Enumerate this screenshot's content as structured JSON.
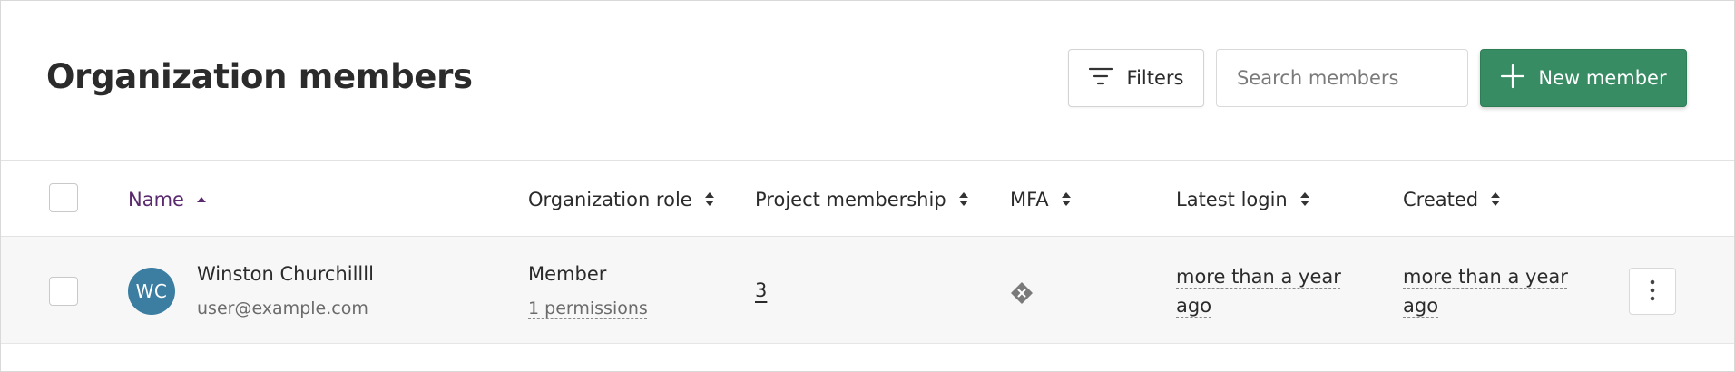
{
  "header": {
    "title": "Organization members",
    "filters_label": "Filters",
    "search_placeholder": "Search members",
    "new_member_label": "New member"
  },
  "table": {
    "columns": [
      {
        "key": "name",
        "label": "Name",
        "sort": "asc"
      },
      {
        "key": "role",
        "label": "Organization role",
        "sort": "none"
      },
      {
        "key": "projects",
        "label": "Project membership",
        "sort": "none"
      },
      {
        "key": "mfa",
        "label": "MFA",
        "sort": "none"
      },
      {
        "key": "latest_login",
        "label": "Latest login",
        "sort": "none"
      },
      {
        "key": "created",
        "label": "Created",
        "sort": "none"
      }
    ],
    "rows": [
      {
        "avatar_initials": "WC",
        "name": "Winston Churchillll",
        "email": "user@example.com",
        "role": "Member",
        "permissions": "1 permissions",
        "project_count": "3",
        "mfa": "disabled-icon",
        "latest_login": "more than a year ago",
        "created": "more than a year ago"
      }
    ]
  },
  "colors": {
    "accent_green": "#378c63",
    "active_sort": "#5b2a6e",
    "avatar_bg": "#3b7ea1"
  }
}
